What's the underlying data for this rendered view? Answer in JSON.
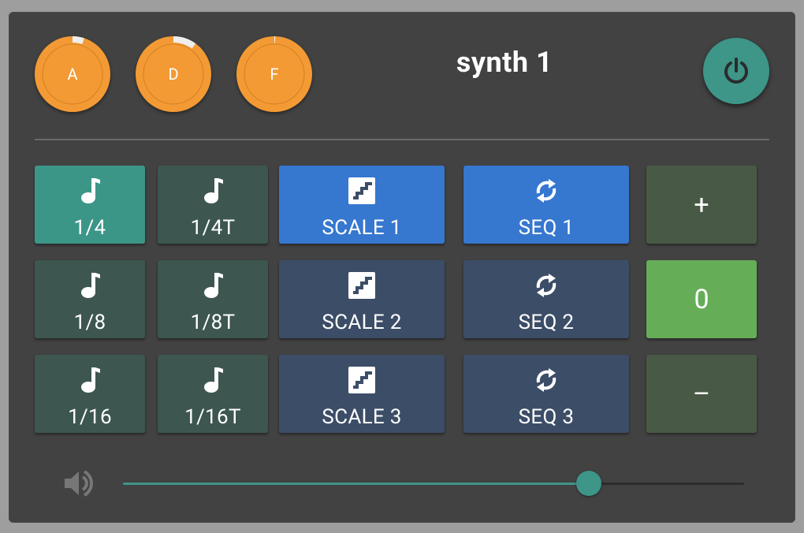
{
  "header": {
    "title": "synth 1",
    "power_icon": "power-icon"
  },
  "knobs": [
    {
      "label": "A",
      "value": 0.05
    },
    {
      "label": "D",
      "value": 0.1
    },
    {
      "label": "F",
      "value": 0.0
    }
  ],
  "note_buttons": [
    {
      "label": "1/4",
      "icon": "music-note-icon",
      "active": true
    },
    {
      "label": "1/4T",
      "icon": "music-note-icon",
      "active": false
    },
    {
      "label": "1/8",
      "icon": "music-note-icon",
      "active": false
    },
    {
      "label": "1/8T",
      "icon": "music-note-icon",
      "active": false
    },
    {
      "label": "1/16",
      "icon": "music-note-icon",
      "active": false
    },
    {
      "label": "1/16T",
      "icon": "music-note-icon",
      "active": false
    }
  ],
  "scale_buttons": [
    {
      "label": "SCALE 1",
      "icon": "stairs-icon",
      "active": true
    },
    {
      "label": "SCALE 2",
      "icon": "stairs-icon",
      "active": false
    },
    {
      "label": "SCALE 3",
      "icon": "stairs-icon",
      "active": false
    }
  ],
  "seq_buttons": [
    {
      "label": "SEQ 1",
      "icon": "sync-icon",
      "active": true
    },
    {
      "label": "SEQ 2",
      "icon": "sync-icon",
      "active": false
    },
    {
      "label": "SEQ 3",
      "icon": "sync-icon",
      "active": false
    }
  ],
  "stepper": {
    "plus_label": "+",
    "value": "0",
    "minus_label": "–"
  },
  "volume": {
    "icon": "volume-icon",
    "level": 0.75
  },
  "colors": {
    "accent_teal": "#3d9688",
    "knob_orange": "#f39a34",
    "active_blue": "#3677cf",
    "value_green": "#66ad58"
  }
}
